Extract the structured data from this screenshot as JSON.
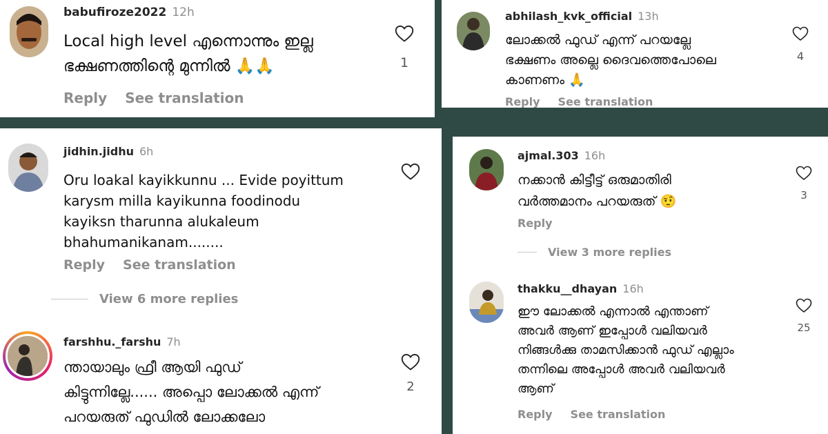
{
  "comments": [
    {
      "username": "babufiroze2022",
      "time": "12h",
      "lines": [
        "Local high level എന്നൊന്നും ഇല്ല",
        "ഭക്ഷണത്തിന്റെ മുന്നിൽ 🙏🙏"
      ],
      "likes": "1",
      "actions": [
        "Reply",
        "See translation"
      ]
    },
    {
      "username": "abhilash_kvk_official",
      "time": "13h",
      "lines": [
        "ലോക്കൽ ഫുഡ് എന്ന് പറയല്ലേ",
        "ഭക്ഷണം അല്ലെ ദൈവത്തെപോലെ",
        "കാണണം 🙏"
      ],
      "likes": "4",
      "actions": [
        "Reply",
        "See translation"
      ]
    },
    {
      "username": "jidhin.jidhu",
      "time": "6h",
      "lines": [
        "Oru loakal kayikkunnu ... Evide poyittum",
        "karysm milla  kayikunna foodinodu",
        "kayiksn tharunna alukaleum",
        "bhahumanikanam........"
      ],
      "likes": "",
      "actions": [
        "Reply",
        "See translation"
      ],
      "more_replies": "View 6 more replies"
    },
    {
      "username": "ajmal.303",
      "time": "16h",
      "lines": [
        "നക്കാൻ കിട്ടീട്ട് ഒരുമാതിരി",
        "വർത്തമാനം പറയരുത് 🤨"
      ],
      "likes": "3",
      "actions": [
        "Reply"
      ],
      "more_replies": "View 3 more replies"
    },
    {
      "username": "farshhu._farshu",
      "time": "7h",
      "lines": [
        "ന്തായാലും ഫ്രീ ആയി ഫുഡ്",
        "കിട്ടുന്നില്ലേ...... അപ്പൊ ലോക്കൽ എന്ന്",
        "പറയരുത്  ഫുഡിൽ ലോക്കലോ"
      ],
      "likes": "2"
    },
    {
      "username": "thakku__dhayan",
      "time": "16h",
      "lines": [
        "ഈ ലോക്കൽ എന്നാൽ എന്താണ്",
        "അവർ ആണ് ഇപ്പോൾ വലിയവർ",
        "നിങ്ങൾക്കു താമസിക്കാൻ ഫുഡ് എല്ലാം",
        "തന്നിലെ  അപ്പോൾ അവർ വലിയവർ",
        "ആണ്"
      ],
      "likes": "25",
      "actions": [
        "Reply",
        "See translation"
      ]
    }
  ],
  "icons": {
    "like": "heart-outline-icon",
    "avatar": "user-avatar"
  },
  "colors": {
    "background": "#2f4a44",
    "muted": "#8e8e8e"
  }
}
